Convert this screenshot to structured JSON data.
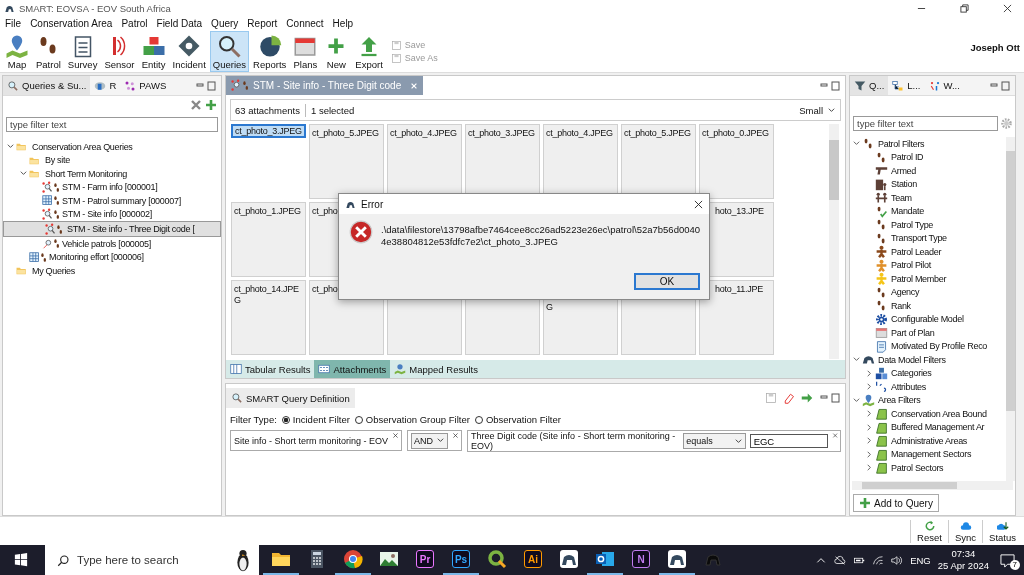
{
  "window": {
    "title": "SMART: EOVSA - EOV South Africa"
  },
  "menu": [
    "File",
    "Conservation Area",
    "Patrol",
    "Field Data",
    "Query",
    "Report",
    "Connect",
    "Help"
  ],
  "toolbar": [
    {
      "label": "Map",
      "kind": "map",
      "selected": false
    },
    {
      "label": "Patrol",
      "kind": "footprints",
      "selected": false
    },
    {
      "label": "Survey",
      "kind": "clipboard",
      "selected": false
    },
    {
      "label": "Sensor",
      "kind": "sensor",
      "selected": false
    },
    {
      "label": "Entity",
      "kind": "entity",
      "selected": false
    },
    {
      "label": "Incident",
      "kind": "incident",
      "selected": false
    },
    {
      "label": "Queries",
      "kind": "search",
      "selected": true
    },
    {
      "label": "Reports",
      "kind": "pie",
      "selected": false
    },
    {
      "label": "Plans",
      "kind": "calendar",
      "selected": false
    },
    {
      "label": "New",
      "kind": "plus",
      "selected": false
    },
    {
      "label": "Export",
      "kind": "export",
      "selected": false
    }
  ],
  "save_actions": [
    {
      "label": "Save",
      "disabled": true
    },
    {
      "label": "Save As",
      "disabled": true
    }
  ],
  "user": "Joseph Ott",
  "left_panel": {
    "tabs": [
      {
        "label": "Queries & Su...",
        "kind": "search",
        "selected": true
      },
      {
        "label": "R",
        "kind": "r",
        "selected": false
      },
      {
        "label": "PAWS",
        "kind": "paws",
        "selected": false
      }
    ],
    "filter": {
      "placeholder": "type filter text"
    },
    "tree": [
      {
        "label": "Conservation Area Queries",
        "kind": "folder",
        "selected": false,
        "expanded": true,
        "children": [
          {
            "label": "By site",
            "kind": "folder",
            "selected": false
          },
          {
            "label": "Short Term Monitoring",
            "kind": "folder",
            "selected": false,
            "expanded": true,
            "children": [
              {
                "label": "STM - Farm info [000001]",
                "kind": "map-query",
                "selected": false
              },
              {
                "label": "STM - Patrol summary [000007]",
                "kind": "table-query",
                "selected": false
              },
              {
                "label": "STM - Site info [000002]",
                "kind": "map-query",
                "selected": false
              },
              {
                "label": "STM - Site info - Three Digit code [",
                "kind": "map-query",
                "selected": true
              },
              {
                "label": "Vehicle patrols [000005]",
                "kind": "query",
                "selected": false
              }
            ]
          },
          {
            "label": "Monitoring effort [000006]",
            "kind": "table-query",
            "selected": false
          }
        ]
      },
      {
        "label": "My Queries",
        "kind": "folder",
        "selected": false
      }
    ]
  },
  "editor": {
    "tab": "STM - Site info - Three Digit code",
    "count": "63 attachments",
    "selection": "1 selected",
    "size": "Small",
    "tiles": [
      {
        "label": "ct_photo_3.JPEG",
        "selected": true
      },
      {
        "label": "ct_photo_5.JPEG",
        "selected": false
      },
      {
        "label": "ct_photo_4.JPEG",
        "selected": false
      },
      {
        "label": "ct_photo_3.JPEG",
        "selected": false
      },
      {
        "label": "ct_photo_4.JPEG",
        "selected": false
      },
      {
        "label": "ct_photo_5.JPEG",
        "selected": false
      },
      {
        "label": "ct_photo_0.JPEG",
        "selected": false
      },
      {
        "label": "ct_photo_1.JPEG",
        "selected": false
      },
      {
        "label": "ct_pho",
        "selected": false
      },
      {
        "label": "hoto_13.JPE",
        "kind": "covered",
        "selected": false
      },
      {
        "label": "ct_photo_14.JPEG",
        "selected": false
      },
      {
        "label": "ct_pho",
        "selected": false
      },
      {
        "selected": false
      },
      {
        "selected": false
      },
      {
        "label": "G",
        "kind": "second-line",
        "selected": false
      },
      {
        "selected": false
      },
      {
        "label": "hoto_11.JPE",
        "kind": "covered",
        "selected": false
      }
    ],
    "result_tabs": [
      {
        "label": "Tabular Results",
        "kind": "table",
        "selected": false
      },
      {
        "label": "Attachments",
        "kind": "grid",
        "selected": true
      },
      {
        "label": "Mapped Results",
        "kind": "pin",
        "selected": false
      }
    ]
  },
  "dialog": {
    "title": "Error",
    "message": ".\\data\\filestore\\13798afbe7464cee8cc26ad5223e26ec\\patrol\\52a7b56d00404e38804812e53fdfc7e2\\ct_photo_3.JPEG",
    "button": "OK"
  },
  "query_definition": {
    "title": "SMART Query Definition",
    "filter_type_label": "Filter Type:",
    "filter_types": [
      {
        "label": "Incident Filter",
        "selected": true
      },
      {
        "label": "Observation Group Filter",
        "selected": false
      },
      {
        "label": "Observation Filter",
        "selected": false
      }
    ],
    "source": "Site info - Short term monitoring - EOV",
    "operator": "AND",
    "condition": "Three Digit code (Site info - Short term monitoring - EOV)",
    "comparison": "equals",
    "value": "EGC"
  },
  "right_panel": {
    "tabs": [
      {
        "label": "Q...",
        "kind": "filter",
        "selected": true
      },
      {
        "label": "L...",
        "kind": "layers",
        "selected": false
      },
      {
        "label": "W...",
        "kind": "weights",
        "selected": false
      }
    ],
    "filter": {
      "placeholder": "type filter text"
    },
    "tree": [
      {
        "label": "Patrol Filters",
        "kind": "footprints",
        "expanded": true,
        "children": [
          {
            "label": "Patrol ID",
            "kind": "footprints"
          },
          {
            "label": "Armed",
            "kind": "gun"
          },
          {
            "label": "Station",
            "kind": "station"
          },
          {
            "label": "Team",
            "kind": "team"
          },
          {
            "label": "Mandate",
            "kind": "mandate"
          },
          {
            "label": "Patrol Type",
            "kind": "footprints"
          },
          {
            "label": "Transport Type",
            "kind": "footprints"
          },
          {
            "label": "Patrol Leader",
            "kind": "person",
            "color": "#8b4a1c"
          },
          {
            "label": "Patrol Pilot",
            "kind": "person",
            "color": "#e0902a"
          },
          {
            "label": "Patrol Member",
            "kind": "person",
            "color": "#f5c518"
          },
          {
            "label": "Agency",
            "kind": "footprints"
          },
          {
            "label": "Rank",
            "kind": "footprints"
          },
          {
            "label": "Configurable Model",
            "kind": "gear"
          },
          {
            "label": "Part of Plan",
            "kind": "calendar"
          },
          {
            "label": "Motivated By Profile Reco",
            "kind": "document"
          }
        ]
      },
      {
        "label": "Data Model Filters",
        "kind": "animal",
        "expanded": true,
        "children": [
          {
            "label": "Categories",
            "kind": "blocks",
            "expanded": false
          },
          {
            "label": "Attributes",
            "kind": "numbers",
            "expanded": false
          }
        ]
      },
      {
        "label": "Area Filters",
        "kind": "map",
        "expanded": true,
        "children": [
          {
            "label": "Conservation Area Bound",
            "kind": "polygon",
            "expanded": false
          },
          {
            "label": "Buffered Management Ar",
            "kind": "polygon",
            "expanded": false
          },
          {
            "label": "Administrative Areas",
            "kind": "polygon",
            "expanded": false
          },
          {
            "label": "Management Sectors",
            "kind": "polygon",
            "expanded": false
          },
          {
            "label": "Patrol Sectors",
            "kind": "polygon",
            "expanded": false
          }
        ]
      }
    ],
    "add_button": "Add to Query"
  },
  "status_bar": [
    {
      "label": "Reset",
      "kind": "reset"
    },
    {
      "label": "Sync",
      "kind": "sync"
    },
    {
      "label": "Status",
      "kind": "status"
    }
  ],
  "taskbar": {
    "search_placeholder": "Type here to search",
    "apps": [
      {
        "kind": "folder",
        "running": true
      },
      {
        "kind": "calculator",
        "running": false
      },
      {
        "kind": "chrome",
        "running": true
      },
      {
        "kind": "photo",
        "running": false
      },
      {
        "kind": "letters",
        "label": "Pr",
        "color": "#ea77ff",
        "running": false
      },
      {
        "kind": "letters",
        "label": "Ps",
        "color": "#31a8ff",
        "running": true
      },
      {
        "kind": "qgis",
        "running": false
      },
      {
        "kind": "letters",
        "label": "Ai",
        "color": "#ff9a00",
        "running": false
      },
      {
        "kind": "smart",
        "running": false
      },
      {
        "kind": "outlook",
        "running": true
      },
      {
        "kind": "letters",
        "label": "N",
        "color": "#c07cf0",
        "running": false
      },
      {
        "kind": "smart",
        "running": true
      },
      {
        "kind": "smart-dark",
        "running": false
      }
    ],
    "language": "ENG",
    "time": "07:34",
    "date": "25 Apr 2024",
    "notifications": "7"
  }
}
